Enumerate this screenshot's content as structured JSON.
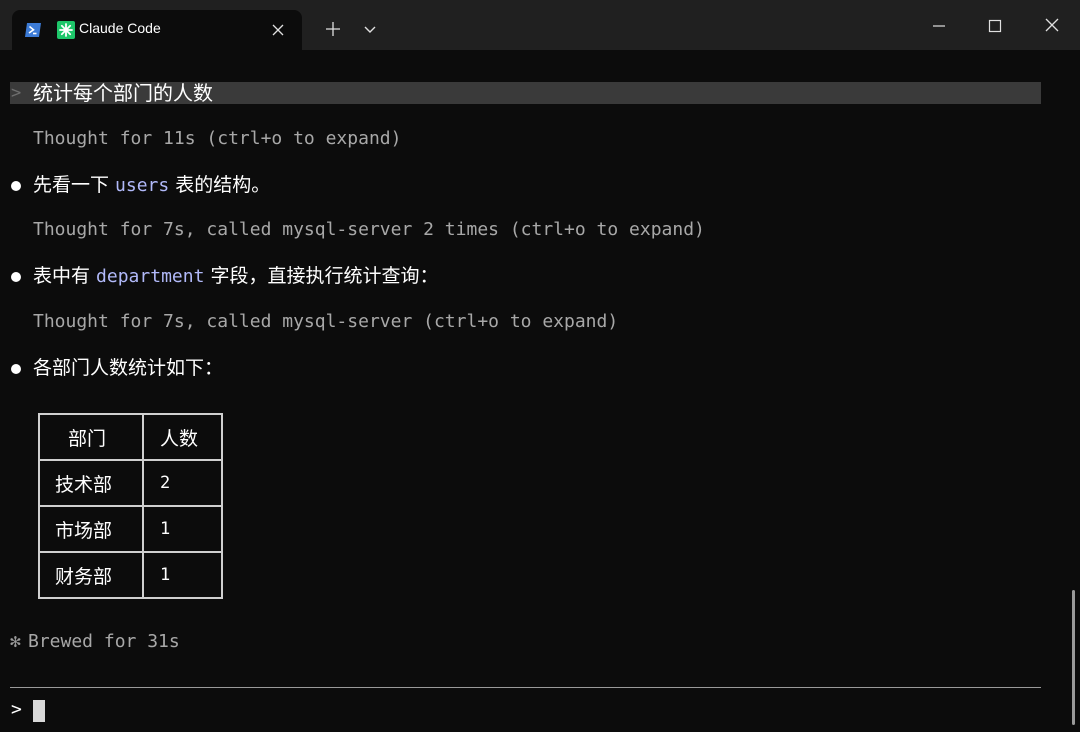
{
  "titlebar": {
    "tab_title": "Claude Code",
    "icons": {
      "shell": "powershell-icon",
      "app": "claude-asterisk-icon",
      "tab_close": "close-icon",
      "new_tab": "plus-icon",
      "dropdown": "chevron-down-icon",
      "minimize": "minimize-icon",
      "maximize": "maximize-icon",
      "close": "close-icon"
    }
  },
  "colors": {
    "background": "#0c0c0c",
    "titlebar": "#202020",
    "code_accent": "#b1b9f9",
    "muted_text": "#a8a8a8",
    "echo_highlight": "#3a3a3a",
    "app_icon": "#1ec66a"
  },
  "conversation": {
    "prompt_caret": ">",
    "user_prompt": "统计每个部门的人数",
    "thought_1": "Thought for 11s (ctrl+o to expand)",
    "message_1": {
      "before": "先看一下 ",
      "code": "users",
      "after": " 表的结构。"
    },
    "thought_2": "Thought for 7s, called mysql-server 2 times (ctrl+o to expand)",
    "message_2": {
      "before": "表中有 ",
      "code": "department",
      "after": " 字段，直接执行统计查询："
    },
    "thought_3": "Thought for 7s, called mysql-server (ctrl+o to expand)",
    "message_3": "各部门人数统计如下：",
    "table": {
      "headers": [
        "部门",
        "人数"
      ],
      "rows": [
        [
          "技术部",
          "2"
        ],
        [
          "市场部",
          "1"
        ],
        [
          "财务部",
          "1"
        ]
      ]
    },
    "status_icon": "✻",
    "status": "Brewed for 31s"
  },
  "input": {
    "caret": ">",
    "value": ""
  }
}
